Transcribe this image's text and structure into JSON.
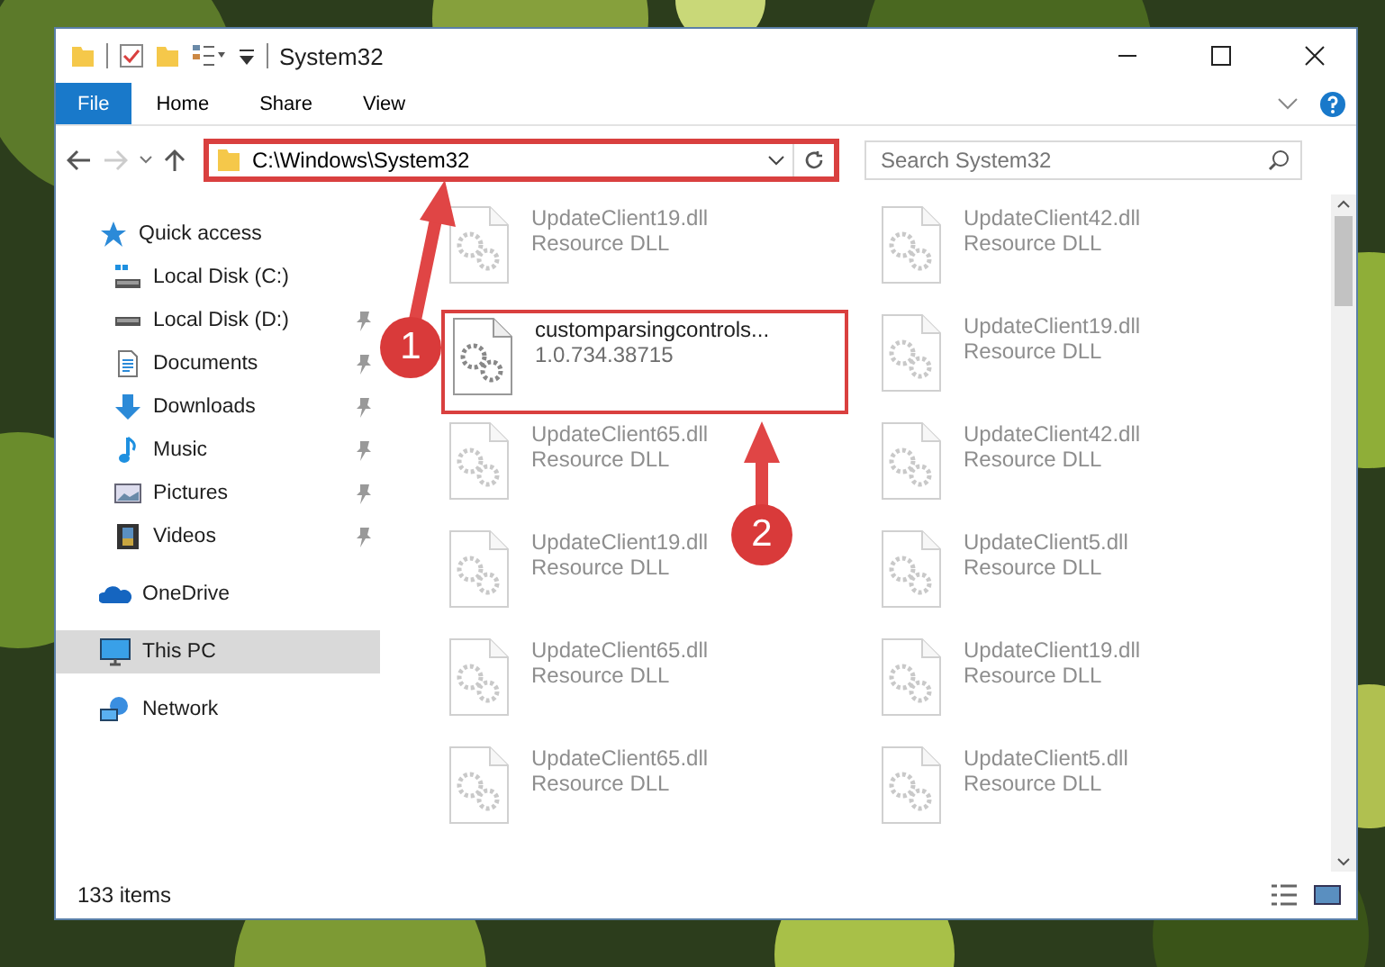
{
  "window": {
    "title": "System32"
  },
  "ribbon_tabs": [
    {
      "label": "File",
      "kind": "file_menu"
    },
    {
      "label": "Home",
      "kind": "tab"
    },
    {
      "label": "Share",
      "kind": "tab"
    },
    {
      "label": "View",
      "kind": "tab"
    }
  ],
  "address_bar": {
    "path": "C:\\Windows\\System32",
    "highlighted": true
  },
  "search": {
    "placeholder": "Search System32"
  },
  "navigation": [
    {
      "label": "Quick access",
      "kind": "star",
      "selected": false,
      "pinned": false,
      "children": [
        {
          "label": "Local Disk (C:)",
          "kind": "system_drive",
          "selected": false,
          "pinned": false
        },
        {
          "label": "Local Disk (D:)",
          "kind": "drive",
          "selected": false,
          "pinned": true
        },
        {
          "label": "Documents",
          "kind": "document",
          "selected": false,
          "pinned": true
        },
        {
          "label": "Downloads",
          "kind": "download",
          "selected": false,
          "pinned": true
        },
        {
          "label": "Music",
          "kind": "music",
          "selected": false,
          "pinned": true
        },
        {
          "label": "Pictures",
          "kind": "picture",
          "selected": false,
          "pinned": true
        },
        {
          "label": "Videos",
          "kind": "video",
          "selected": false,
          "pinned": true
        }
      ]
    },
    {
      "label": "OneDrive",
      "kind": "cloud",
      "selected": false,
      "pinned": false
    },
    {
      "label": "This PC",
      "kind": "pc",
      "selected": true,
      "pinned": false
    },
    {
      "label": "Network",
      "kind": "network",
      "selected": false,
      "pinned": false
    }
  ],
  "files": [
    {
      "name": "UpdateClient19.dll",
      "detail": "Resource DLL",
      "faded": true,
      "highlighted": false
    },
    {
      "name": "UpdateClient42.dll",
      "detail": "Resource DLL",
      "faded": true,
      "highlighted": false
    },
    {
      "name": "customparsingcontrols...",
      "detail": "1.0.734.38715",
      "faded": false,
      "highlighted": true
    },
    {
      "name": "UpdateClient19.dll",
      "detail": "Resource DLL",
      "faded": true,
      "highlighted": false
    },
    {
      "name": "UpdateClient65.dll",
      "detail": "Resource DLL",
      "faded": true,
      "highlighted": false
    },
    {
      "name": "UpdateClient42.dll",
      "detail": "Resource DLL",
      "faded": true,
      "highlighted": false
    },
    {
      "name": "UpdateClient19.dll",
      "detail": "Resource DLL",
      "faded": true,
      "highlighted": false
    },
    {
      "name": "UpdateClient5.dll",
      "detail": "Resource DLL",
      "faded": true,
      "highlighted": false
    },
    {
      "name": "UpdateClient65.dll",
      "detail": "Resource DLL",
      "faded": true,
      "highlighted": false
    },
    {
      "name": "UpdateClient19.dll",
      "detail": "Resource DLL",
      "faded": true,
      "highlighted": false
    },
    {
      "name": "UpdateClient65.dll",
      "detail": "Resource DLL",
      "faded": true,
      "highlighted": false
    },
    {
      "name": "UpdateClient5.dll",
      "detail": "Resource DLL",
      "faded": true,
      "highlighted": false
    }
  ],
  "status_bar": {
    "item_count": "133 items"
  },
  "annotations": [
    {
      "number": "1"
    },
    {
      "number": "2"
    }
  ]
}
